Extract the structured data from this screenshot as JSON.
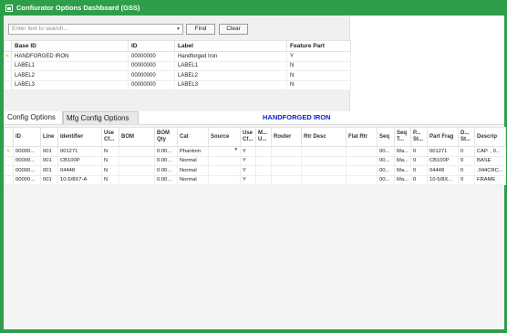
{
  "window": {
    "title": "Confiurator Options Dashboard (GSS)"
  },
  "search": {
    "placeholder": "Enter text to search...",
    "find_label": "Find",
    "clear_label": "Clear"
  },
  "options_grid": {
    "columns": [
      "Base ID",
      "ID",
      "Label",
      "Feature Part"
    ],
    "rows": [
      {
        "base_id": "HANDFORGED IRON",
        "id": "00000000",
        "label": "Handforged Iron",
        "feature_part": "Y"
      },
      {
        "base_id": "LABEL1",
        "id": "00000000",
        "label": "LABEL1",
        "feature_part": "N"
      },
      {
        "base_id": "LABEL2",
        "id": "00000000",
        "label": "LABEL2",
        "feature_part": "N"
      },
      {
        "base_id": "LABEL3",
        "id": "00000000",
        "label": "LABEL3",
        "feature_part": "N"
      }
    ]
  },
  "tabs": {
    "config_options": "Config Options",
    "mfg_config_options": "Mfg Config Options"
  },
  "selected_part": "HANDFORGED IRON",
  "mfg_grid": {
    "columns": [
      "ID",
      "Line",
      "Identifier",
      "Use Cf...",
      "BOM",
      "BOM Qty",
      "Cat",
      "Source",
      "Use Cf...",
      "M... U...",
      "Router",
      "Rtr Desc",
      "Flat Rtr",
      "Seq",
      "Seq T...",
      "P... St...",
      "Part Frag",
      "D... St...",
      "Descrip"
    ],
    "rows": [
      [
        "00000...",
        "001",
        "001271",
        "N",
        "",
        "0.00...",
        "Phantom",
        "",
        "Y",
        "",
        "",
        "",
        "",
        "00...",
        "Ma...",
        "0",
        "001271",
        "0",
        "CAP. , 0..."
      ],
      [
        "00000...",
        "001",
        "CB100P",
        "N",
        "",
        "0.00...",
        "Normal",
        "",
        "Y",
        "",
        "",
        "",
        "",
        "00...",
        "Ma...",
        "0",
        "CB100P",
        "0",
        "BASE"
      ],
      [
        "00000...",
        "001",
        "04448",
        "N",
        "",
        "0.00...",
        "Normal",
        "",
        "Y",
        "",
        "",
        "",
        "",
        "00...",
        "Ma...",
        "0",
        "04448",
        "0",
        ".044CRC..."
      ],
      [
        "00000...",
        "001",
        "10-5/8X7-A",
        "N",
        "",
        "0.00...",
        "Normal",
        "",
        "Y",
        "",
        "",
        "",
        "",
        "00...",
        "Ma...",
        "0",
        "10-5/8X...",
        "0",
        "FRAME"
      ]
    ]
  },
  "colors": {
    "frame": "#2e9e4a",
    "part_title": "#0a1ed8",
    "row_indicator": "#d69a00"
  },
  "icons": {
    "app": "app-icon",
    "row_indicator": "pencil-icon",
    "dropdown": "chevron-down-icon"
  }
}
